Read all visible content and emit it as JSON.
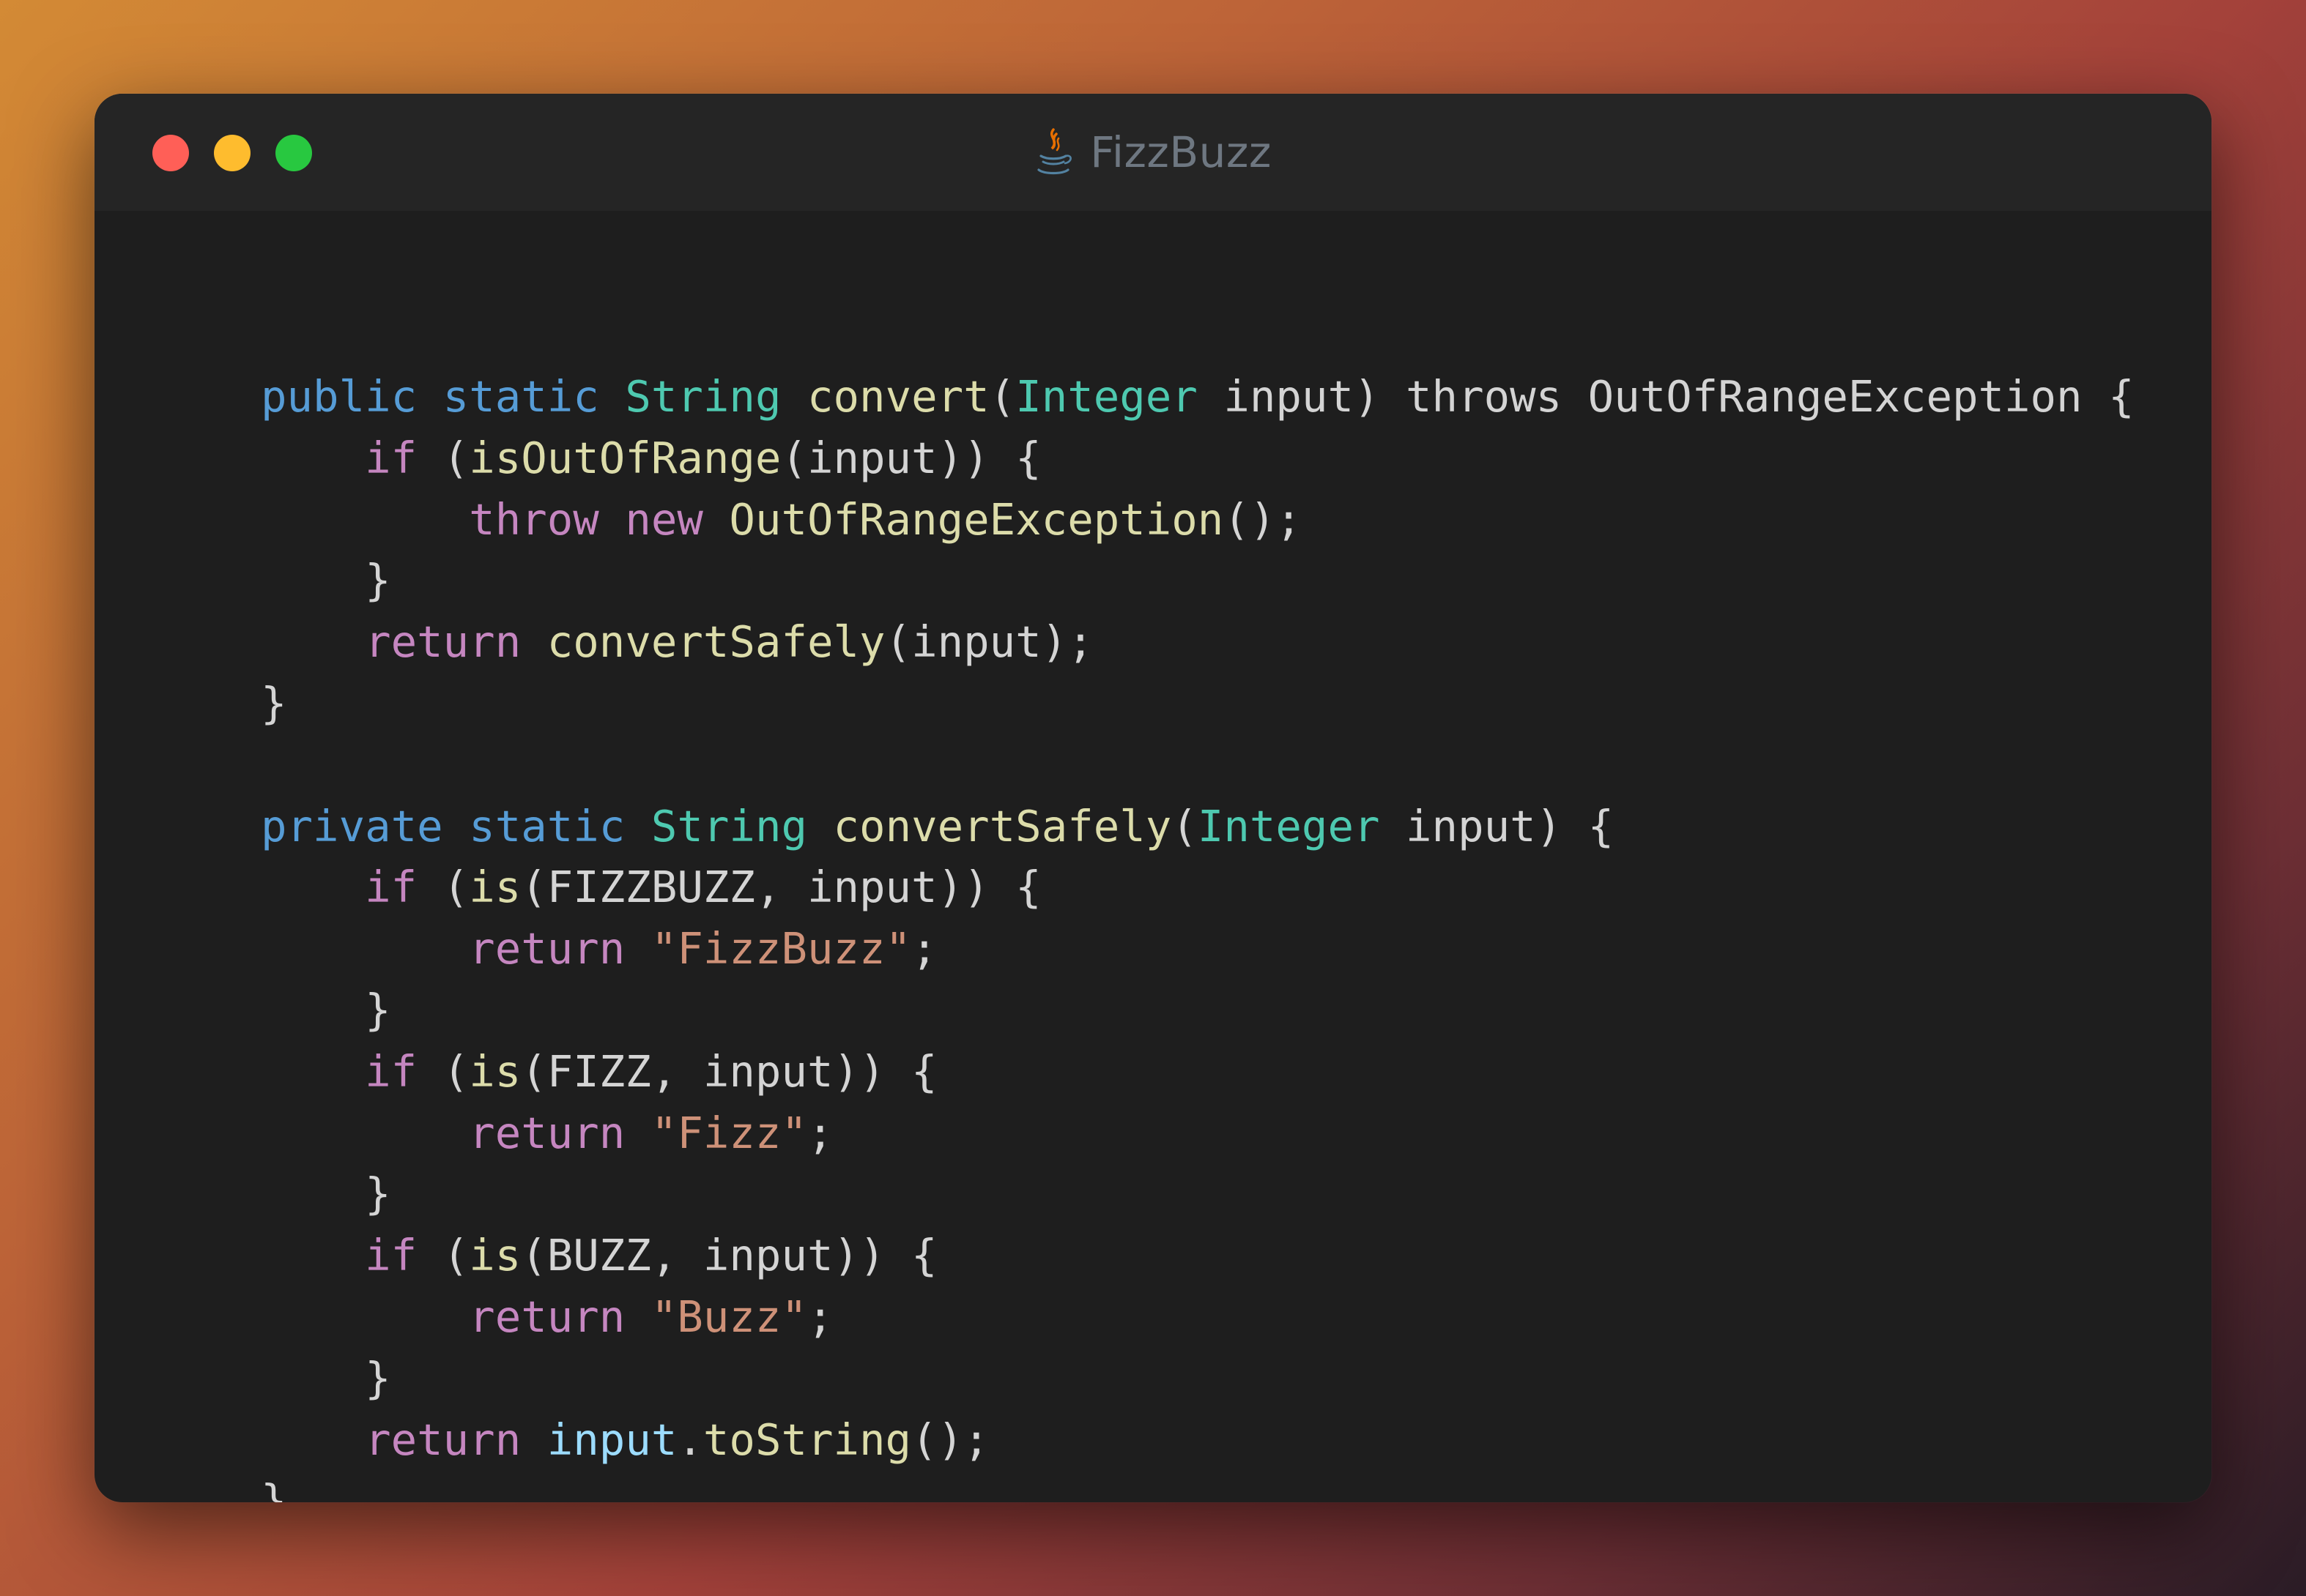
{
  "window": {
    "title": "FizzBuzz",
    "icon": "java-cup-icon",
    "traffic_lights": {
      "close_color": "#ff5f57",
      "minimize_color": "#febc2e",
      "zoom_color": "#28c840"
    }
  },
  "theme": {
    "background": "#1e1e1e",
    "titlebar": "#252525",
    "colors": {
      "modifier": "#569cd6",
      "type": "#4ec9b0",
      "function": "#dcdcaa",
      "control": "#c586c0",
      "string": "#ce9178",
      "variable": "#9cdcfe",
      "plain": "#d4d4d4"
    }
  },
  "code": {
    "lines": [
      {
        "indent": 0,
        "tokens": [
          {
            "t": "public",
            "c": "modifier"
          },
          {
            "t": " ",
            "c": "plain"
          },
          {
            "t": "static",
            "c": "modifier"
          },
          {
            "t": " ",
            "c": "plain"
          },
          {
            "t": "String",
            "c": "type"
          },
          {
            "t": " ",
            "c": "plain"
          },
          {
            "t": "convert",
            "c": "function"
          },
          {
            "t": "(",
            "c": "plain"
          },
          {
            "t": "Integer",
            "c": "type"
          },
          {
            "t": " input) throws OutOfRangeException {",
            "c": "plain"
          }
        ]
      },
      {
        "indent": 1,
        "tokens": [
          {
            "t": "if",
            "c": "control"
          },
          {
            "t": " (",
            "c": "plain"
          },
          {
            "t": "isOutOfRange",
            "c": "function"
          },
          {
            "t": "(input)) {",
            "c": "plain"
          }
        ]
      },
      {
        "indent": 2,
        "tokens": [
          {
            "t": "throw",
            "c": "control"
          },
          {
            "t": " ",
            "c": "plain"
          },
          {
            "t": "new",
            "c": "control"
          },
          {
            "t": " ",
            "c": "plain"
          },
          {
            "t": "OutOfRangeException",
            "c": "function"
          },
          {
            "t": "();",
            "c": "plain"
          }
        ]
      },
      {
        "indent": 1,
        "tokens": [
          {
            "t": "}",
            "c": "plain"
          }
        ]
      },
      {
        "indent": 1,
        "tokens": [
          {
            "t": "return",
            "c": "control"
          },
          {
            "t": " ",
            "c": "plain"
          },
          {
            "t": "convertSafely",
            "c": "function"
          },
          {
            "t": "(input);",
            "c": "plain"
          }
        ]
      },
      {
        "indent": 0,
        "tokens": [
          {
            "t": "}",
            "c": "plain"
          }
        ]
      },
      {
        "indent": 0,
        "tokens": []
      },
      {
        "indent": 0,
        "tokens": [
          {
            "t": "private",
            "c": "modifier"
          },
          {
            "t": " ",
            "c": "plain"
          },
          {
            "t": "static",
            "c": "modifier"
          },
          {
            "t": " ",
            "c": "plain"
          },
          {
            "t": "String",
            "c": "type"
          },
          {
            "t": " ",
            "c": "plain"
          },
          {
            "t": "convertSafely",
            "c": "function"
          },
          {
            "t": "(",
            "c": "plain"
          },
          {
            "t": "Integer",
            "c": "type"
          },
          {
            "t": " input) {",
            "c": "plain"
          }
        ]
      },
      {
        "indent": 1,
        "tokens": [
          {
            "t": "if",
            "c": "control"
          },
          {
            "t": " (",
            "c": "plain"
          },
          {
            "t": "is",
            "c": "function"
          },
          {
            "t": "(FIZZBUZZ, input)) {",
            "c": "plain"
          }
        ]
      },
      {
        "indent": 2,
        "tokens": [
          {
            "t": "return",
            "c": "control"
          },
          {
            "t": " ",
            "c": "plain"
          },
          {
            "t": "\"FizzBuzz\"",
            "c": "string"
          },
          {
            "t": ";",
            "c": "plain"
          }
        ]
      },
      {
        "indent": 1,
        "tokens": [
          {
            "t": "}",
            "c": "plain"
          }
        ]
      },
      {
        "indent": 1,
        "tokens": [
          {
            "t": "if",
            "c": "control"
          },
          {
            "t": " (",
            "c": "plain"
          },
          {
            "t": "is",
            "c": "function"
          },
          {
            "t": "(FIZZ, input)) {",
            "c": "plain"
          }
        ]
      },
      {
        "indent": 2,
        "tokens": [
          {
            "t": "return",
            "c": "control"
          },
          {
            "t": " ",
            "c": "plain"
          },
          {
            "t": "\"Fizz\"",
            "c": "string"
          },
          {
            "t": ";",
            "c": "plain"
          }
        ]
      },
      {
        "indent": 1,
        "tokens": [
          {
            "t": "}",
            "c": "plain"
          }
        ]
      },
      {
        "indent": 1,
        "tokens": [
          {
            "t": "if",
            "c": "control"
          },
          {
            "t": " (",
            "c": "plain"
          },
          {
            "t": "is",
            "c": "function"
          },
          {
            "t": "(BUZZ, input)) {",
            "c": "plain"
          }
        ]
      },
      {
        "indent": 2,
        "tokens": [
          {
            "t": "return",
            "c": "control"
          },
          {
            "t": " ",
            "c": "plain"
          },
          {
            "t": "\"Buzz\"",
            "c": "string"
          },
          {
            "t": ";",
            "c": "plain"
          }
        ]
      },
      {
        "indent": 1,
        "tokens": [
          {
            "t": "}",
            "c": "plain"
          }
        ]
      },
      {
        "indent": 1,
        "tokens": [
          {
            "t": "return",
            "c": "control"
          },
          {
            "t": " ",
            "c": "plain"
          },
          {
            "t": "input",
            "c": "variable"
          },
          {
            "t": ".",
            "c": "plain"
          },
          {
            "t": "toString",
            "c": "function"
          },
          {
            "t": "();",
            "c": "plain"
          }
        ]
      },
      {
        "indent": 0,
        "tokens": [
          {
            "t": "}",
            "c": "plain"
          }
        ]
      }
    ]
  }
}
